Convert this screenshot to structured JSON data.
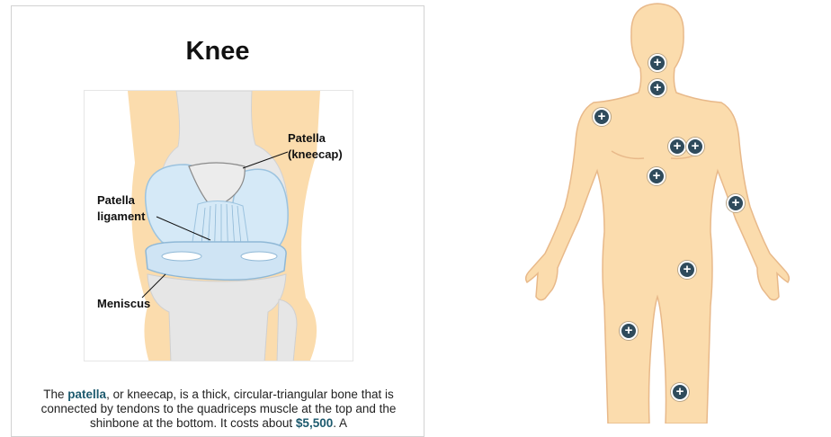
{
  "card": {
    "title": "Knee",
    "labels": {
      "patella_line1": "Patella",
      "patella_line2": "(kneecap)",
      "ligament_line1": "Patella",
      "ligament_line2": "ligament",
      "meniscus": "Meniscus"
    },
    "description": {
      "p1": "The ",
      "link1": "patella",
      "p2": ", or kneecap, is a thick, circular-triangular bone that is connected by tendons to the quadriceps muscle at the top and the shinbone at the bottom. It costs about ",
      "price": "$5,500",
      "p3": ". A"
    }
  },
  "body_map": {
    "hotspots": [
      {
        "id": "head",
        "icon": "plus-icon",
        "symbol": "+"
      },
      {
        "id": "neck",
        "icon": "plus-icon",
        "symbol": "+"
      },
      {
        "id": "shoulder",
        "icon": "plus-icon",
        "symbol": "+"
      },
      {
        "id": "chest-left",
        "icon": "plus-icon",
        "symbol": "+"
      },
      {
        "id": "chest-right",
        "icon": "plus-icon",
        "symbol": "+"
      },
      {
        "id": "abdomen",
        "icon": "plus-icon",
        "symbol": "+"
      },
      {
        "id": "elbow",
        "icon": "plus-icon",
        "symbol": "+"
      },
      {
        "id": "hip",
        "icon": "plus-icon",
        "symbol": "+"
      },
      {
        "id": "thigh",
        "icon": "plus-icon",
        "symbol": "+"
      },
      {
        "id": "knee",
        "icon": "plus-icon",
        "symbol": "+"
      }
    ]
  },
  "colors": {
    "skin": "#fbdcad",
    "skin_outline": "#e8b98a",
    "hotspot": "#2f4b5c",
    "accent_link": "#1d5a6e",
    "cartilage": "#cfe4f4",
    "bone": "#e4e4e4"
  }
}
